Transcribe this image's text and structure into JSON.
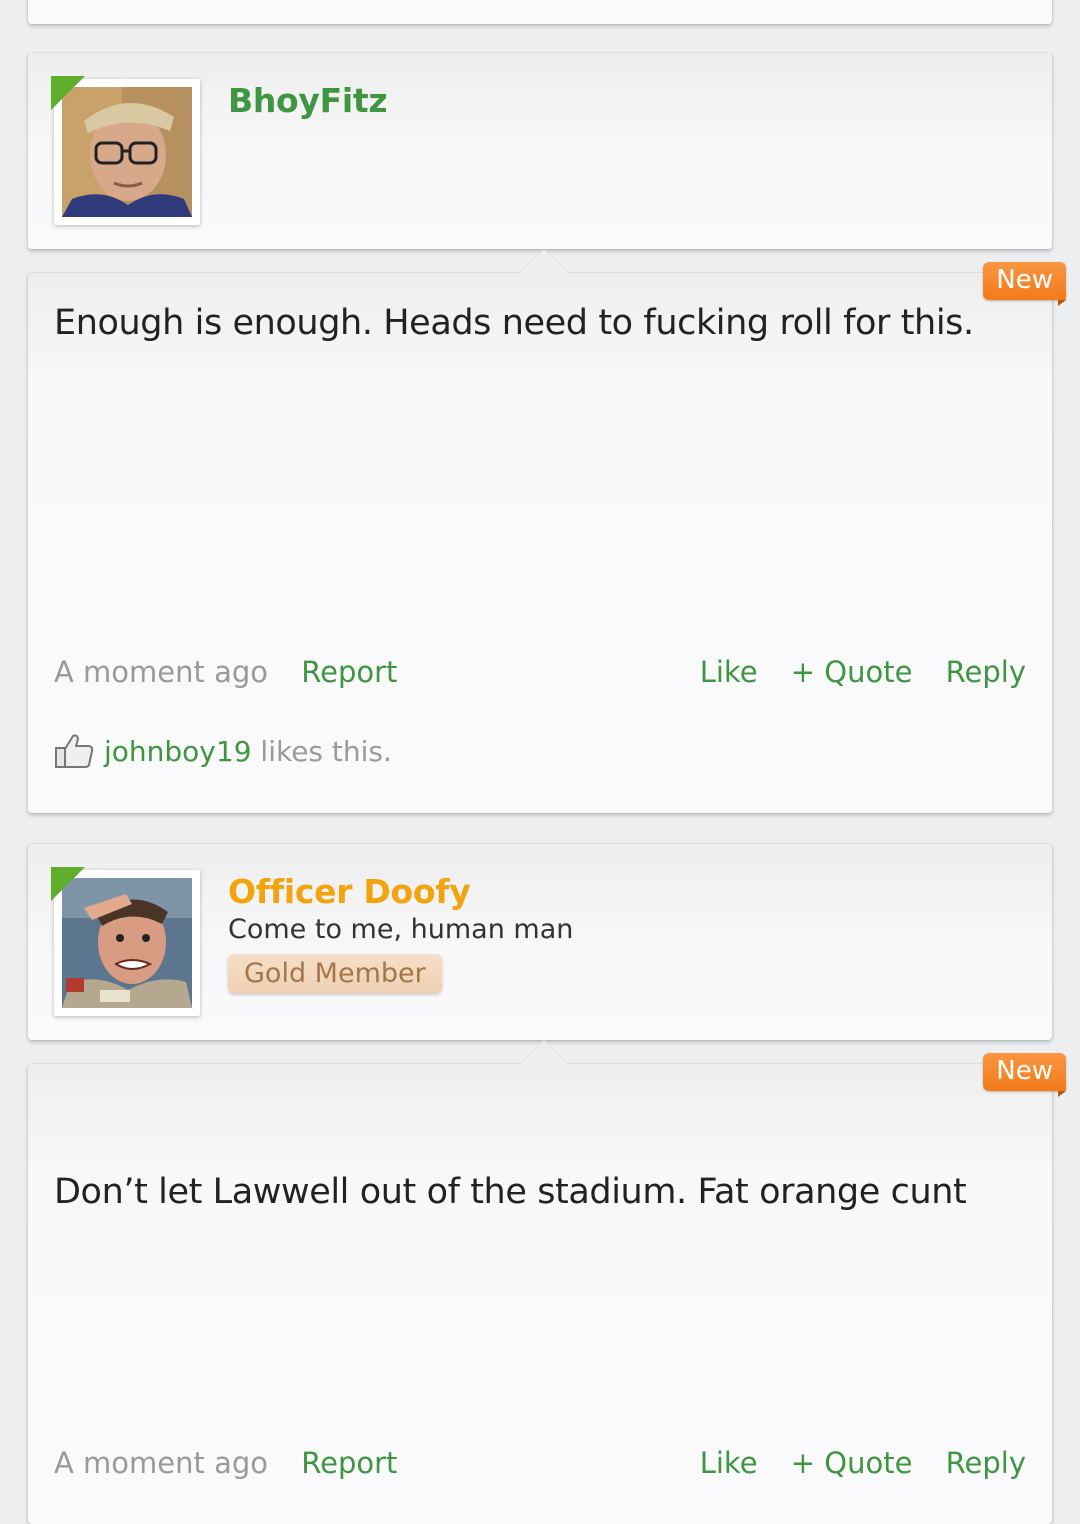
{
  "posts": [
    {
      "username": "BhoyFitz",
      "username_color": "#3e9640",
      "new_label": "New",
      "text": "Enough is enough. Heads need to fucking roll for this.",
      "timestamp": "A moment ago",
      "report": "Report",
      "like": "Like",
      "quote": "+ Quote",
      "reply": "Reply",
      "liker": "johnboy19",
      "likes_suffix": " likes this."
    },
    {
      "username": "Officer Doofy",
      "username_color": "#f2a40f",
      "user_title": "Come to me, human man",
      "badge": "Gold Member",
      "new_label": "New",
      "text": "Don’t let Lawwell out of the stadium. Fat orange cunt",
      "timestamp": "A moment ago",
      "report": "Report",
      "like": "Like",
      "quote": "+ Quote",
      "reply": "Reply"
    }
  ],
  "colors": {
    "accent_green": "#3e9640",
    "online_indicator": "#5fae2b",
    "new_badge": "#f58220",
    "gold_badge_bg": "#f2d6ba",
    "gold_badge_text": "#a4764a"
  }
}
